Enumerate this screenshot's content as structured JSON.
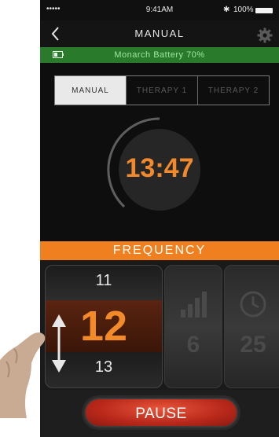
{
  "status_bar": {
    "signal": "•••••",
    "time": "9:41AM",
    "bluetooth": "✱",
    "battery_pct": "100%"
  },
  "nav": {
    "title": "MANUAL",
    "back_icon": "chevron-left-icon",
    "settings_icon": "gear-icon"
  },
  "battery": {
    "text": "Monarch Battery 70%",
    "icon": "battery-icon"
  },
  "tabs": [
    {
      "label": "MANUAL",
      "active": true
    },
    {
      "label": "THERAPY 1",
      "active": false
    },
    {
      "label": "THERAPY 2",
      "active": false
    }
  ],
  "timer": {
    "value": "13:47"
  },
  "frequency": {
    "label": "FREQUENCY",
    "prev": "11",
    "current": "12",
    "next": "13"
  },
  "intensity": {
    "value": "6",
    "icon": "signal-bars-icon"
  },
  "duration": {
    "value": "25",
    "icon": "clock-icon"
  },
  "pause": {
    "label": "PAUSE"
  },
  "colors": {
    "accent": "#f07f1f",
    "battery_bar": "#2a7a2c",
    "pause": "#c8301e",
    "background": "#0e0e0e"
  }
}
